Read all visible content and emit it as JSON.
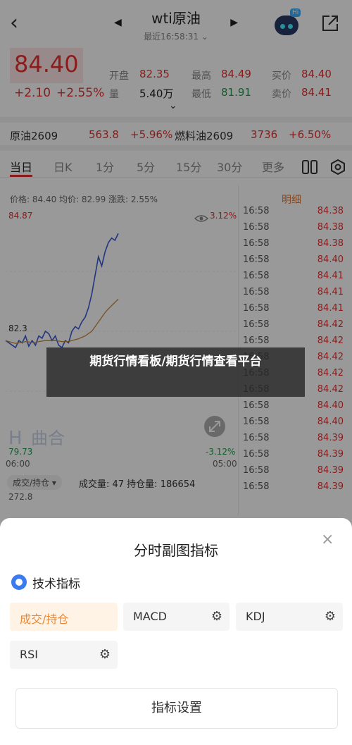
{
  "header": {
    "back_glyph": "‹",
    "prev_glyph": "◀",
    "next_glyph": "▶",
    "title": "wti原油",
    "subtitle": "最近16:58:31 ⌄",
    "robot_badge": "Hi"
  },
  "quote": {
    "price": "84.40",
    "change": "+2.10",
    "change_pct": "+2.55%",
    "stats": [
      {
        "label": "开盘",
        "value": "82.35",
        "color": "red"
      },
      {
        "label": "最高",
        "value": "84.49",
        "color": "red"
      },
      {
        "label": "买价",
        "value": "84.40",
        "color": "red"
      },
      {
        "label": "量",
        "value": "5.40万",
        "color": "dark"
      },
      {
        "label": "最低",
        "value": "81.91",
        "color": "green"
      },
      {
        "label": "卖价",
        "value": "84.41",
        "color": "red"
      }
    ],
    "expand_glyph": "⌄"
  },
  "related": [
    {
      "name": "原油2609",
      "price": "563.8",
      "pct": "+5.96%"
    },
    {
      "name": "燃料油2609",
      "price": "3736",
      "pct": "+6.50%"
    }
  ],
  "tabs": [
    "当日",
    "日K",
    "1分",
    "5分",
    "15分",
    "30分",
    "更多"
  ],
  "chart": {
    "info": "价格: 84.40  均价: 82.99  涨跌: 2.55%",
    "y_top": "84.87",
    "y_top_pct": "3.12%",
    "y_mid": "82.3",
    "y_bottom": "79.73",
    "y_bottom_pct": "-3.12%",
    "x_start": "06:00",
    "x_end": "05:00",
    "watermark": "曲合",
    "watermark_logo": "H"
  },
  "chart_data": {
    "type": "line",
    "series": [
      {
        "values": [
          82.1,
          82.05,
          82.0,
          81.95,
          82.1,
          82.05,
          82.2,
          81.98,
          82.1,
          82.0,
          82.2,
          82.15,
          82.3,
          82.25,
          82.1,
          82.2,
          82.0,
          81.95,
          82.1,
          82.05,
          82.3,
          82.4,
          82.35,
          82.5,
          82.6,
          82.8,
          83.1,
          83.5,
          83.9,
          83.7,
          84.0,
          84.2,
          84.3,
          84.25,
          84.4
        ]
      },
      {
        "values": [
          82.1,
          82.08,
          82.06,
          82.04,
          82.05,
          82.06,
          82.08,
          82.07,
          82.06,
          82.06,
          82.08,
          82.09,
          82.1,
          82.1,
          82.1,
          82.1,
          82.09,
          82.08,
          82.08,
          82.08,
          82.1,
          82.12,
          82.14,
          82.17,
          82.2,
          82.25,
          82.3,
          82.4,
          82.5,
          82.6,
          82.7,
          82.78,
          82.85,
          82.92,
          82.99
        ]
      }
    ],
    "ylim": [
      79.73,
      84.87
    ]
  },
  "detail": {
    "title": "明细",
    "rows": [
      {
        "time": "16:58",
        "price": "84.38"
      },
      {
        "time": "16:58",
        "price": "84.38"
      },
      {
        "time": "16:58",
        "price": "84.38"
      },
      {
        "time": "16:58",
        "price": "84.40"
      },
      {
        "time": "16:58",
        "price": "84.41"
      },
      {
        "time": "16:58",
        "price": "84.41"
      },
      {
        "time": "16:58",
        "price": "84.41"
      },
      {
        "time": "16:58",
        "price": "84.42"
      },
      {
        "time": "16:58",
        "price": "84.42"
      },
      {
        "time": "16:58",
        "price": "84.42"
      },
      {
        "time": "16:58",
        "price": "84.42"
      },
      {
        "time": "16:58",
        "price": "84.42"
      },
      {
        "time": "16:58",
        "price": "84.40"
      },
      {
        "time": "16:58",
        "price": "84.40"
      },
      {
        "time": "16:58",
        "price": "84.39"
      },
      {
        "time": "16:58",
        "price": "84.39"
      },
      {
        "time": "16:58",
        "price": "84.39"
      },
      {
        "time": "16:58",
        "price": "84.39"
      }
    ]
  },
  "volume": {
    "selector": "成交/持仓 ▾",
    "info": "成交量: 47  持仓量: 186654",
    "max": "272.8"
  },
  "banner": {
    "text": "期货行情看板/期货行情查看平台"
  },
  "sheet": {
    "title": "分时副图指标",
    "close": "×",
    "section": "技术指标",
    "chips": [
      {
        "label": "成交/持仓",
        "selected": true,
        "gear": false
      },
      {
        "label": "MACD",
        "selected": false,
        "gear": true
      },
      {
        "label": "KDJ",
        "selected": false,
        "gear": true
      },
      {
        "label": "RSI",
        "selected": false,
        "gear": true
      }
    ],
    "button": "指标设置"
  },
  "colors": {
    "up": "#e93030",
    "down": "#1f9d4c",
    "accent": "#e88a3a"
  }
}
